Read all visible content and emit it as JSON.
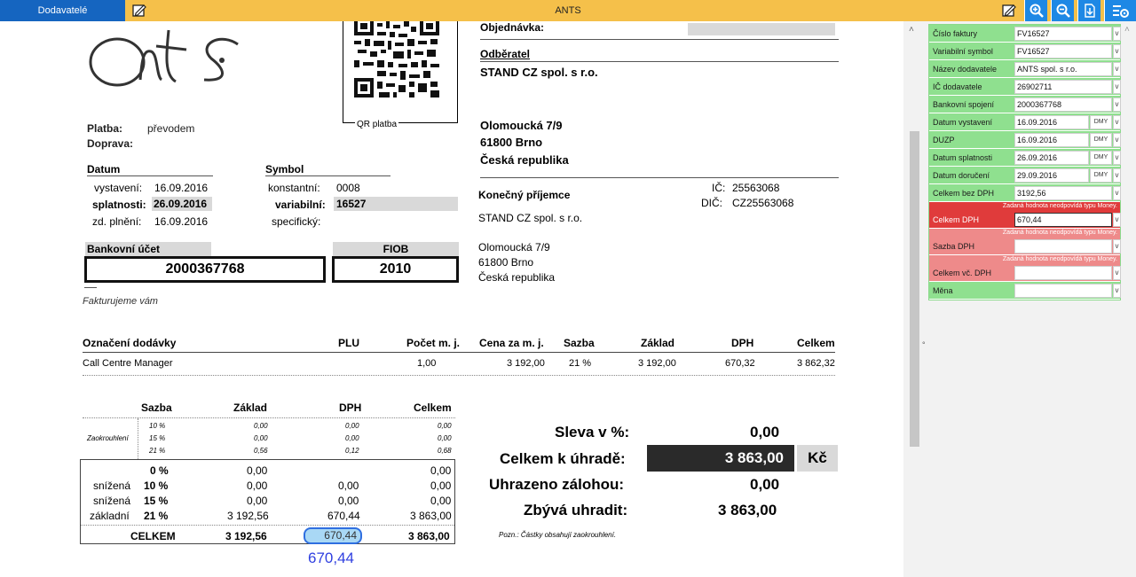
{
  "toolbar": {
    "tab_label": "Dodavatelé",
    "app_title": "ANTS",
    "icons": [
      "edit-icon",
      "zoom-in-icon",
      "zoom-out-icon",
      "download-icon",
      "settings-icon"
    ]
  },
  "invoice": {
    "logo_text": "ants",
    "qr_label": "QR platba",
    "platba_label": "Platba:",
    "platba_value": "převodem",
    "doprava_label": "Doprava:",
    "datum_header": "Datum",
    "vystaveni_label": "vystavení:",
    "vystaveni_value": "16.09.2016",
    "splatnosti_label": "splatnosti:",
    "splatnosti_value": "26.09.2016",
    "plneni_label": "zd. plnění:",
    "plneni_value": "16.09.2016",
    "symbol_header": "Symbol",
    "konstantni_label": "konstantní:",
    "konstantni_value": "0008",
    "variabilni_label": "variabilní:",
    "variabilni_value": "16527",
    "specificky_label": "specifický:",
    "bank_header": "Bankovní účet",
    "bank_value": "2000367768",
    "fiob_header": "FIOB",
    "fiob_value": "2010",
    "fakturujeme": "Fakturujeme vám",
    "objednavka_label": "Objednávka:",
    "odberatel_label": "Odběratel",
    "odberatel_name": "STAND CZ spol. s r.o.",
    "odberatel_street": "Olomoucká 7/9",
    "odberatel_city": "61800  Brno",
    "odberatel_country": "Česká republika",
    "konecny_label": "Konečný příjemce",
    "ic_label": "IČ:",
    "ic_value": "25563068",
    "dic_label": "DIČ:",
    "dic_value": "CZ25563068",
    "konecny_name": "STAND CZ spol. s r.o.",
    "konecny_street": "Olomoucká 7/9",
    "konecny_city": "61800  Brno",
    "konecny_country": "Česká republika"
  },
  "items_table": {
    "headers": [
      "Označení dodávky",
      "PLU",
      "Počet  m. j.",
      "Cena za m. j.",
      "Sazba",
      "Základ",
      "DPH",
      "Celkem"
    ],
    "row": {
      "name": "Call Centre Manager",
      "plu": "",
      "pocet": "1,00",
      "cena": "3 192,00",
      "sazba": "21  %",
      "zaklad": "3 192,00",
      "dph": "670,32",
      "celkem": "3 862,32"
    }
  },
  "vat_table": {
    "headers": [
      "Sazba",
      "Základ",
      "DPH",
      "Celkem"
    ],
    "zaokrouhleni_label": "Zaokrouhlení",
    "rounding_rows": [
      {
        "sazba": "10  %",
        "zaklad": "0,00",
        "dph": "0,00",
        "celkem": "0,00"
      },
      {
        "sazba": "15  %",
        "zaklad": "0,00",
        "dph": "0,00",
        "celkem": "0,00"
      },
      {
        "sazba": "21  %",
        "zaklad": "0,56",
        "dph": "0,12",
        "celkem": "0,68"
      }
    ],
    "rate_rows": [
      {
        "label": "",
        "sazba": "0  %",
        "zaklad": "0,00",
        "dph": "",
        "celkem": "0,00"
      },
      {
        "label": "snížená",
        "sazba": "10  %",
        "zaklad": "0,00",
        "dph": "0,00",
        "celkem": "0,00"
      },
      {
        "label": "snížená",
        "sazba": "15  %",
        "zaklad": "0,00",
        "dph": "0,00",
        "celkem": "0,00"
      },
      {
        "label": "základní",
        "sazba": "21  %",
        "zaklad": "3 192,56",
        "dph": "670,44",
        "celkem": "3 863,00"
      }
    ],
    "total_label": "CELKEM",
    "total_zaklad": "3 192,56",
    "total_dph": "670,44",
    "total_celkem": "3 863,00",
    "ocr_value": "670,44"
  },
  "summary": {
    "sleva_label": "Sleva v %:",
    "sleva_value": "0,00",
    "celkem_label": "Celkem k úhradě:",
    "celkem_value": "3 863,00",
    "currency": "Kč",
    "zaloha_label": "Uhrazeno zálohou:",
    "zaloha_value": "0,00",
    "zbyva_label": "Zbývá uhradit:",
    "zbyva_value": "3 863,00",
    "note": "Pozn.: Částky obsahují zaokrouhlení."
  },
  "fields": [
    {
      "label": "Číslo faktury",
      "value": "FV16527"
    },
    {
      "label": "Variabilní symbol",
      "value": "FV16527"
    },
    {
      "label": "Název dodavatele",
      "value": "ANTS spol. s r.o."
    },
    {
      "label": "IČ dodavatele",
      "value": "26902711"
    },
    {
      "label": "Bankovní spojení",
      "value": "2000367768"
    },
    {
      "label": "Datum vystavení",
      "value": "16.09.2016",
      "dmy": "DMY"
    },
    {
      "label": "DUZP",
      "value": "16.09.2016",
      "dmy": "DMY"
    },
    {
      "label": "Datum splatnosti",
      "value": "26.09.2016",
      "dmy": "DMY"
    },
    {
      "label": "Datum doručení",
      "value": "29.09.2016",
      "dmy": "DMY"
    },
    {
      "label": "Celkem bez DPH",
      "value": "3192,56"
    },
    {
      "label": "Celkem DPH",
      "value": "670,44",
      "error": "Zadaná hodnota neodpovídá typu Money."
    },
    {
      "label": "Sazba DPH",
      "value": "",
      "error": "Zadaná hodnota neodpovídá typu Money."
    },
    {
      "label": "Celkem vč. DPH",
      "value": "",
      "error": "Zadaná hodnota neodpovídá typu Money."
    },
    {
      "label": "Měna",
      "value": ""
    }
  ],
  "dropdown_glyph": "v",
  "colors": {
    "toolbar": "#f5c04a",
    "tab": "#1565c0",
    "field_ok": "#8fe08f",
    "field_error": "#e03b3b",
    "field_error_light": "#ee8a8a",
    "highlight": "#a9d8f5",
    "ocr_text": "#2f3fe0"
  }
}
